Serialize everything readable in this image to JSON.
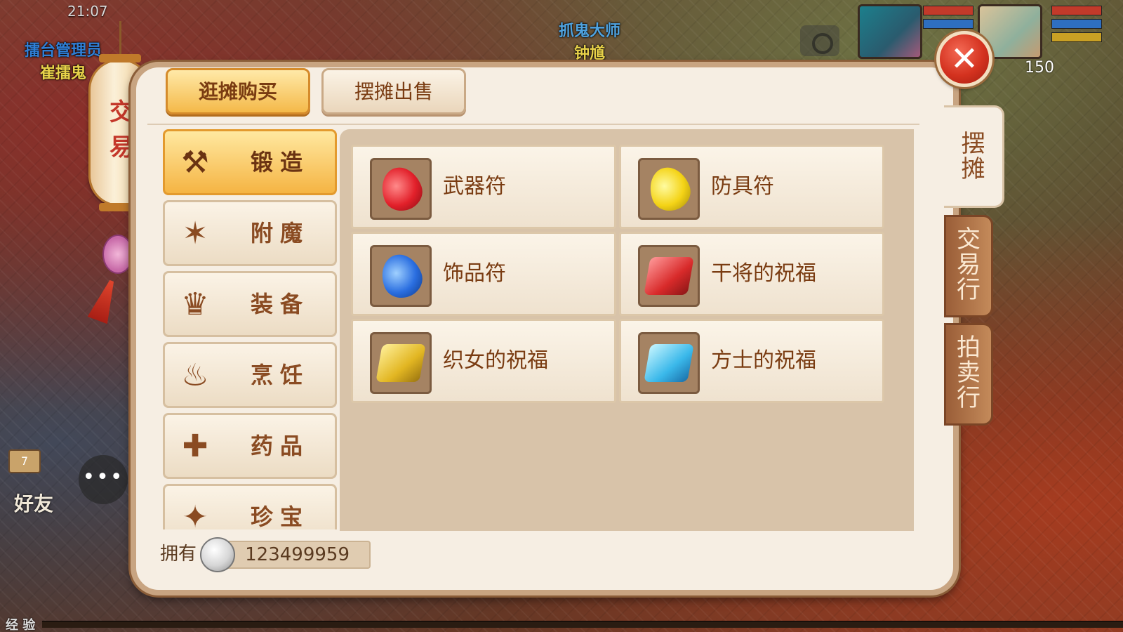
{
  "hud": {
    "time": "21:07",
    "level": "150"
  },
  "npcs": {
    "left_title": "擂台管理员",
    "left_name": "崔擂鬼",
    "top_title": "抓鬼大师",
    "top_name": "钟馗"
  },
  "social": {
    "mail_count": "7",
    "friend_label": "好友",
    "chat_glyph": "•••"
  },
  "exp_label": "经 验",
  "lantern_text": "交 易",
  "top_tabs": {
    "buy": "逛摊购买",
    "sell": "摆摊出售"
  },
  "categories": [
    {
      "label": "锻造",
      "icon": "hammer-icon",
      "glyph": "⚒",
      "active": true
    },
    {
      "label": "附魔",
      "icon": "magic-wand-icon",
      "glyph": "✶",
      "active": false
    },
    {
      "label": "装备",
      "icon": "helmet-icon",
      "glyph": "♛",
      "active": false
    },
    {
      "label": "烹饪",
      "icon": "cooking-pot-icon",
      "glyph": "♨",
      "active": false
    },
    {
      "label": "药品",
      "icon": "medicine-bottle-icon",
      "glyph": "✚",
      "active": false
    },
    {
      "label": "珍宝",
      "icon": "treasure-icon",
      "glyph": "✦",
      "active": false
    }
  ],
  "items": [
    {
      "name": "武器符",
      "icon": "red-gem-icon"
    },
    {
      "name": "防具符",
      "icon": "yellow-gem-icon"
    },
    {
      "name": "饰品符",
      "icon": "blue-gem-icon"
    },
    {
      "name": "干将的祝福",
      "icon": "red-scroll-icon"
    },
    {
      "name": "织女的祝福",
      "icon": "gold-scroll-icon"
    },
    {
      "name": "方士的祝福",
      "icon": "cyan-scroll-icon"
    }
  ],
  "currency": {
    "label": "拥有",
    "amount": "123499959"
  },
  "side_tabs": {
    "stall": "摆\n摊",
    "market": "交\n易\n行",
    "auction": "拍\n卖\n行"
  },
  "colors": {
    "accent_orange": "#f5b443",
    "panel_bg": "#f6eee3",
    "text_brown": "#7a3c12",
    "close_red": "#d4321f"
  }
}
